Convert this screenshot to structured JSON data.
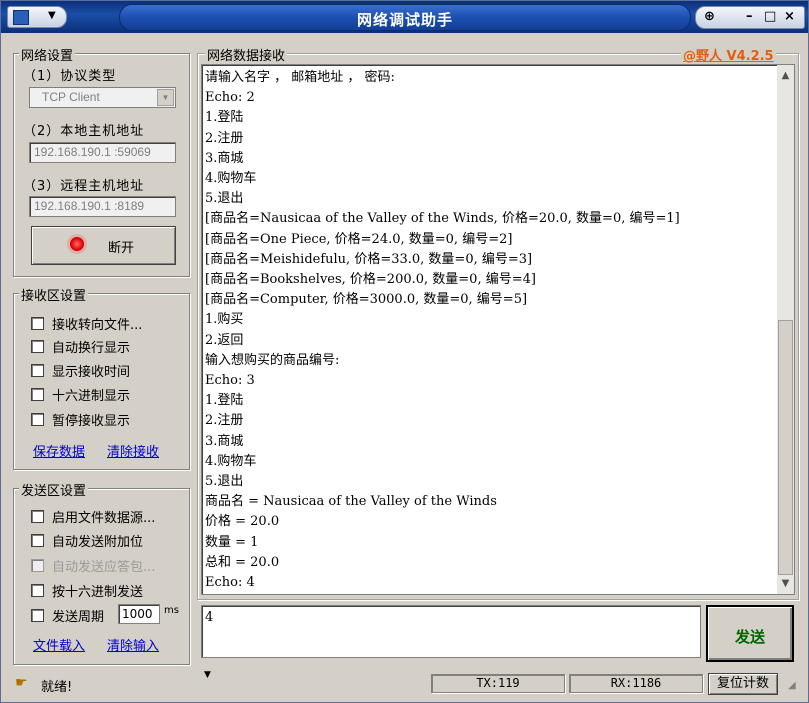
{
  "window": {
    "title": "网络调试助手",
    "version": "@野人 V4.2.5",
    "pin": "⊕",
    "minimize": "–",
    "maximize": "□",
    "close": "×"
  },
  "net": {
    "group": "网络设置",
    "protocol_label": "（1）协议类型",
    "protocol_value": "TCP Client",
    "local_label": "（2）本地主机地址",
    "local_value": "192.168.190.1 :59069",
    "remote_label": "（3）远程主机地址",
    "remote_value": "192.168.190.1 :8189",
    "disconnect": "断开"
  },
  "recv_settings": {
    "group": "接收区设置",
    "options": [
      "接收转向文件...",
      "自动换行显示",
      "显示接收时间",
      "十六进制显示",
      "暂停接收显示"
    ],
    "save": "保存数据",
    "clear": "清除接收"
  },
  "send_settings": {
    "group": "发送区设置",
    "options": [
      "启用文件数据源...",
      "自动发送附加位",
      "自动发送应答包...",
      "按十六进制发送",
      "发送周期"
    ],
    "period": "1000",
    "period_unit": "ms",
    "load": "文件载入",
    "clear": "清除输入"
  },
  "recv": {
    "title": "网络数据接收",
    "lines": [
      "请输入名字 ， 邮箱地址 ， 密码:",
      "Echo: 2",
      "1.登陆",
      "2.注册",
      "3.商城",
      "4.购物车",
      "5.退出",
      "[商品名=Nausicaa of the Valley of the Winds, 价格=20.0, 数量=0, 编号=1]",
      "[商品名=One Piece, 价格=24.0, 数量=0, 编号=2]",
      "[商品名=Meishidefulu, 价格=33.0, 数量=0, 编号=3]",
      "[商品名=Bookshelves, 价格=200.0, 数量=0, 编号=4]",
      "[商品名=Computer, 价格=3000.0, 数量=0, 编号=5]",
      "1.购买",
      "2.返回",
      "输入想购买的商品编号:",
      "Echo: 3",
      "1.登陆",
      "2.注册",
      "3.商城",
      "4.购物车",
      "5.退出",
      "商品名 = Nausicaa of the Valley of the Winds",
      "价格 = 20.0",
      "数量 = 1",
      "总和 = 20.0",
      "Echo: 4"
    ]
  },
  "send": {
    "input": "4",
    "button": "发送"
  },
  "status": {
    "ready": "就绪!",
    "tx": "TX:119",
    "rx": "RX:1186",
    "reset": "复位计数"
  }
}
